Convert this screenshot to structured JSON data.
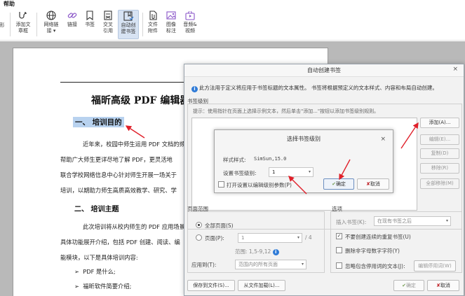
{
  "menubar": {
    "tab": "帮助"
  },
  "ribbon": {
    "partial_left": "形",
    "buttons": [
      {
        "label": "添加文\n章框",
        "icon": "article-box-icon"
      },
      {
        "label": "网络链\n接 ▾",
        "icon": "web-link-icon"
      },
      {
        "label": "链接",
        "icon": "link-icon"
      },
      {
        "label": "书签",
        "icon": "bookmark-icon"
      },
      {
        "label": "交叉\n引用",
        "icon": "cross-reference-icon"
      },
      {
        "label": "自动创\n建书签",
        "icon": "auto-bookmark-icon"
      },
      {
        "label": "文件\n附件",
        "icon": "file-attachment-icon"
      },
      {
        "label": "图像\n标注",
        "icon": "image-annotation-icon"
      },
      {
        "label": "音频&\n视频",
        "icon": "audio-video-icon"
      }
    ]
  },
  "document": {
    "title": "福昕高级 PDF 编辑器",
    "heading1": "一、 培训目的",
    "para1_lines": [
      "近年来，校园中师生运用 PDF 文档的频",
      "帮助广大师生更详尽地了解 PDF，更灵活地",
      "联合学校网络信息中心针对师生开展一场关于",
      "培训，以期助力师生高质高效教学、研究、学"
    ],
    "heading2": "二、 培训主题",
    "para2_lines": [
      "此次培训将从校内师生的 PDF 应用场景",
      "具体功能展开介绍，包括 PDF 创建、阅读、编",
      "能模块，以下是具体培训内容:"
    ],
    "bullets": [
      "PDF 是什么;",
      "福昕软件简要介绍;"
    ],
    "bullet_char": "➢"
  },
  "dialog": {
    "title": "自动创建书签",
    "close": "×",
    "info": "此方法用于定义将应用于书签标题的文本属性。  书签将根据预定义的文本样式、内容和布局自动创建。",
    "section_bookmark_level": "书签级别",
    "hint": "提示：使用指针在页面上选择示例文本，然后单击\"添加...\"按钮以添加书签级别规则。",
    "side_buttons": [
      "添加(A)...",
      "编辑(E)...",
      "复制(D)",
      "移除(R)",
      "全部移除(M)"
    ],
    "section_page_range": "页面范围",
    "radio_all": "全部页面(S)",
    "radio_pages": "页面(P):",
    "pages_value": "1",
    "pages_total": "/ 4",
    "range_hint": "范围: 1,5-9,12",
    "apply_to_label": "应用到(T):",
    "apply_to_value": "范围内的所有页面",
    "section_options": "选项",
    "insert_bookmark_label": "插入书签(K):",
    "insert_bookmark_value": "在现有书签之后",
    "opt1": "不要创建连续的重复书签(U)",
    "opt2": "删除非字母数字字符(Y)",
    "opt3": "忽略包含停用词的文本(J):",
    "edit_stopwords": "编辑停用词(W)",
    "save_to_file": "保存到文件(S)...",
    "load_from_file": "从文件加载(L)...",
    "ok": "确定",
    "cancel": "取消"
  },
  "subdialog": {
    "title": "选择书签级别",
    "close": "×",
    "sample_style_label": "样式样式:",
    "sample_style_value": "SimSun,15.0",
    "level_label": "设置书签级别:",
    "level_value": "1",
    "open_settings": "打开设置以编辑级别参数(P)",
    "ok": "确定",
    "cancel": "取消"
  },
  "colors": {
    "arrow": "#e0202a",
    "selection": "#b8d2ef",
    "accent": "#2f7bd7"
  }
}
